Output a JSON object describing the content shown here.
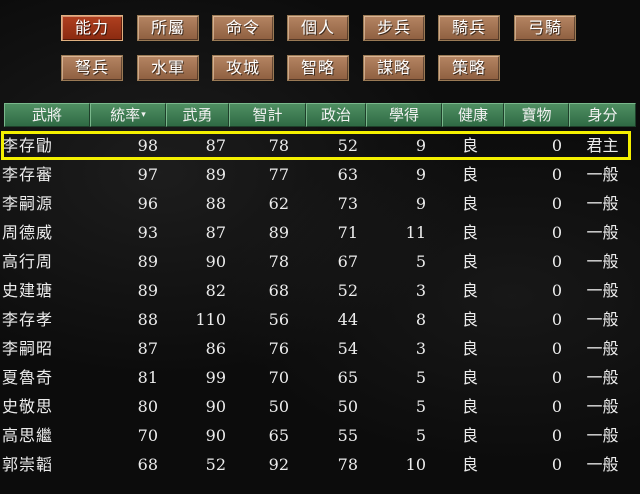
{
  "tabs_row1": [
    "能力",
    "所屬",
    "命令",
    "個人",
    "步兵",
    "騎兵",
    "弓騎"
  ],
  "tabs_row2": [
    "弩兵",
    "水軍",
    "攻城",
    "智略",
    "謀略",
    "策略"
  ],
  "active_tab": "能力",
  "sort_mark": "▾",
  "columns": [
    "武將",
    "統率",
    "武勇",
    "智計",
    "政治",
    "學得",
    "健康",
    "寶物",
    "身分"
  ],
  "rows": [
    {
      "name": "李存勖",
      "tong": "98",
      "wu": "87",
      "zhi": "78",
      "zheng": "52",
      "xue": "9",
      "health": "良",
      "treasure": "0",
      "status": "君主"
    },
    {
      "name": "李存審",
      "tong": "97",
      "wu": "89",
      "zhi": "77",
      "zheng": "63",
      "xue": "9",
      "health": "良",
      "treasure": "0",
      "status": "一般"
    },
    {
      "name": "李嗣源",
      "tong": "96",
      "wu": "88",
      "zhi": "62",
      "zheng": "73",
      "xue": "9",
      "health": "良",
      "treasure": "0",
      "status": "一般"
    },
    {
      "name": "周德威",
      "tong": "93",
      "wu": "87",
      "zhi": "89",
      "zheng": "71",
      "xue": "11",
      "health": "良",
      "treasure": "0",
      "status": "一般"
    },
    {
      "name": "高行周",
      "tong": "89",
      "wu": "90",
      "zhi": "78",
      "zheng": "67",
      "xue": "5",
      "health": "良",
      "treasure": "0",
      "status": "一般"
    },
    {
      "name": "史建瑭",
      "tong": "89",
      "wu": "82",
      "zhi": "68",
      "zheng": "52",
      "xue": "3",
      "health": "良",
      "treasure": "0",
      "status": "一般"
    },
    {
      "name": "李存孝",
      "tong": "88",
      "wu": "110",
      "zhi": "56",
      "zheng": "44",
      "xue": "8",
      "health": "良",
      "treasure": "0",
      "status": "一般"
    },
    {
      "name": "李嗣昭",
      "tong": "87",
      "wu": "86",
      "zhi": "76",
      "zheng": "54",
      "xue": "3",
      "health": "良",
      "treasure": "0",
      "status": "一般"
    },
    {
      "name": "夏魯奇",
      "tong": "81",
      "wu": "99",
      "zhi": "70",
      "zheng": "65",
      "xue": "5",
      "health": "良",
      "treasure": "0",
      "status": "一般"
    },
    {
      "name": "史敬思",
      "tong": "80",
      "wu": "90",
      "zhi": "50",
      "zheng": "50",
      "xue": "5",
      "health": "良",
      "treasure": "0",
      "status": "一般"
    },
    {
      "name": "高思繼",
      "tong": "70",
      "wu": "90",
      "zhi": "65",
      "zheng": "55",
      "xue": "5",
      "health": "良",
      "treasure": "0",
      "status": "一般"
    },
    {
      "name": "郭崇韜",
      "tong": "68",
      "wu": "52",
      "zhi": "92",
      "zheng": "78",
      "xue": "10",
      "health": "良",
      "treasure": "0",
      "status": "一般"
    }
  ],
  "selected_row": 0,
  "colors": {
    "highlight": "#f4f000",
    "header_green": "#3f7d55",
    "tab_brown": "#a97554",
    "tab_active": "#a03818"
  }
}
